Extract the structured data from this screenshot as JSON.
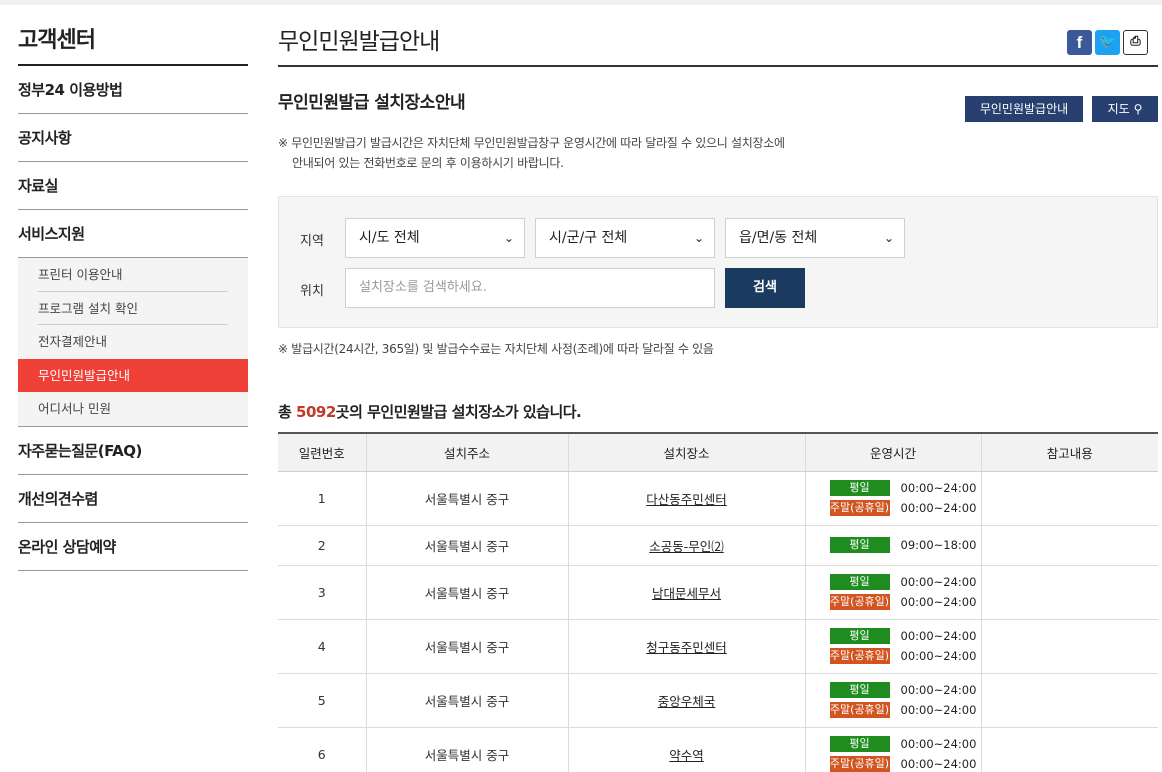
{
  "sidebar": {
    "title": "고객센터",
    "items": [
      {
        "label": "정부24 이용방법"
      },
      {
        "label": "공지사항"
      },
      {
        "label": "자료실"
      },
      {
        "label": "서비스지원"
      }
    ],
    "submenu": [
      {
        "label": "프린터 이용안내"
      },
      {
        "label": "프로그램 설치 확인"
      },
      {
        "label": "전자결제안내"
      },
      {
        "label": "무인민원발급안내"
      },
      {
        "label": "어디서나 민원"
      }
    ],
    "items_after": [
      {
        "label": "자주묻는질문(FAQ)"
      },
      {
        "label": "개선의견수렴"
      },
      {
        "label": "온라인 상담예약"
      }
    ]
  },
  "header": {
    "title": "무인민원발급안내",
    "share_fb": "f",
    "share_tw": "🐦",
    "share_print": "⎙"
  },
  "section": {
    "title": "무인민원발급 설치장소안내",
    "btn_guide": "무인민원발급안내",
    "btn_map": "지도",
    "notice_line1": "※ 무인민원발급기 발급시간은 자치단체 무인민원발급창구 운영시간에 따라 달라질 수 있으니 설치장소에",
    "notice_line2": "안내되어 있는 전화번호로 문의 후 이용하시기 바랍니다."
  },
  "search": {
    "region_label": "지역",
    "location_label": "위치",
    "select_sido": "시/도 전체",
    "select_sigungu": "시/군/구 전체",
    "select_eupmyeondong": "읍/면/동 전체",
    "placeholder": "설치장소를 검색하세요.",
    "button": "검색"
  },
  "footnote": "※ 발급시간(24시간, 365일) 및 발급수수료는 자치단체 사정(조례)에 따라 달라질 수 있음",
  "total": {
    "prefix": "총 ",
    "count": "5092",
    "suffix": "곳의 무인민원발급 설치장소가 있습니다."
  },
  "table": {
    "headers": [
      "일련번호",
      "설치주소",
      "설치장소",
      "운영시간",
      "참고내용"
    ],
    "rows": [
      {
        "no": "1",
        "addr": "서울특별시 중구",
        "place": "다산동주민센터",
        "hours": [
          {
            "type": "평일",
            "time": "00:00~24:00"
          },
          {
            "type": "주말(공휴일)",
            "time": "00:00~24:00"
          }
        ],
        "note": ""
      },
      {
        "no": "2",
        "addr": "서울특별시 중구",
        "place": "소공동-무인⑵",
        "hours": [
          {
            "type": "평일",
            "time": "09:00~18:00"
          }
        ],
        "note": ""
      },
      {
        "no": "3",
        "addr": "서울특별시 중구",
        "place": "남대문세무서",
        "hours": [
          {
            "type": "평일",
            "time": "00:00~24:00"
          },
          {
            "type": "주말(공휴일)",
            "time": "00:00~24:00"
          }
        ],
        "note": ""
      },
      {
        "no": "4",
        "addr": "서울특별시 중구",
        "place": "청구동주민센터",
        "hours": [
          {
            "type": "평일",
            "time": "00:00~24:00"
          },
          {
            "type": "주말(공휴일)",
            "time": "00:00~24:00"
          }
        ],
        "note": ""
      },
      {
        "no": "5",
        "addr": "서울특별시 중구",
        "place": "중앙우체국",
        "hours": [
          {
            "type": "평일",
            "time": "00:00~24:00"
          },
          {
            "type": "주말(공휴일)",
            "time": "00:00~24:00"
          }
        ],
        "note": ""
      },
      {
        "no": "6",
        "addr": "서울특별시 중구",
        "place": "약수역",
        "hours": [
          {
            "type": "평일",
            "time": "00:00~24:00"
          },
          {
            "type": "주말(공휴일)",
            "time": "00:00~24:00"
          }
        ],
        "note": ""
      }
    ]
  },
  "colors": {
    "active_menu": "#ee4036",
    "button_dark": "#27406f",
    "weekday_badge": "#1e8c1e",
    "weekend_badge": "#d2541e",
    "total_count": "#c0392b"
  }
}
